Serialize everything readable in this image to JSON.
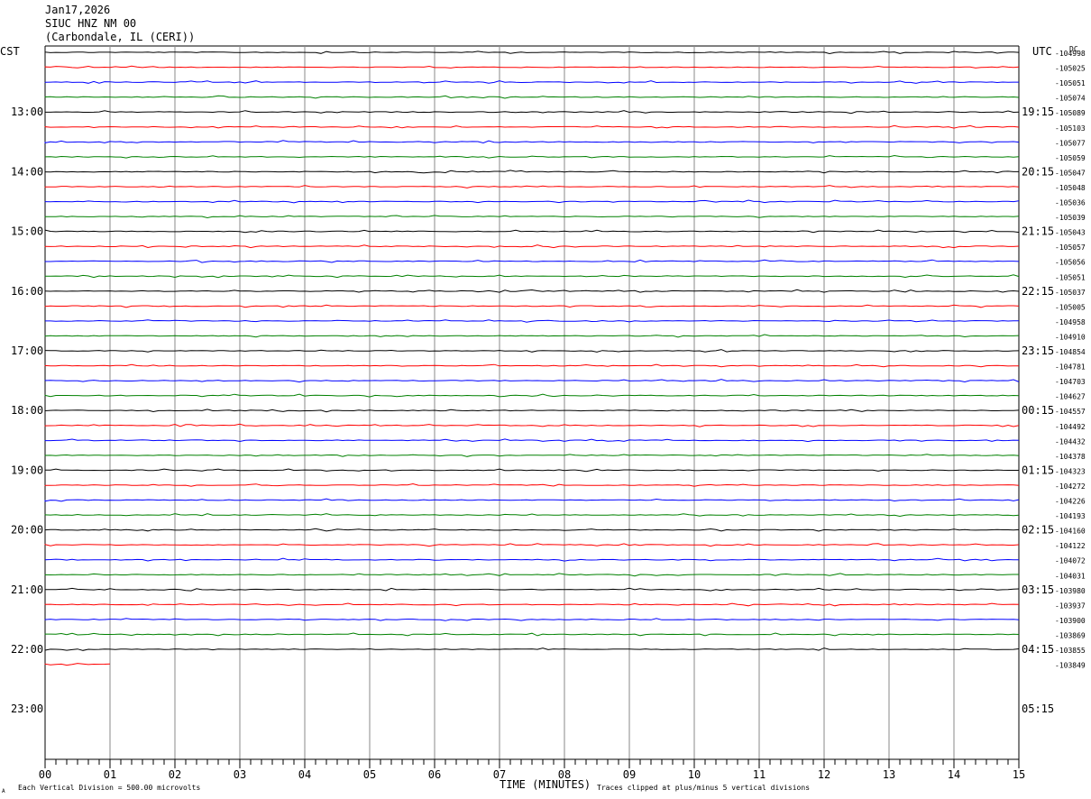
{
  "header": {
    "date": "Jan17,2026",
    "station": "SIUC HNZ NM 00",
    "location": "(Carbondale, IL (CERI))"
  },
  "left_axis_title": "CST",
  "right_axis_title": "UTC",
  "dc_title": "DC",
  "footer": {
    "note_left": "Each Vertical Division =  500.00 microvolts",
    "xlabel": "TIME (MINUTES)",
    "note_right": "Traces clipped at plus/minus 5 vertical divisions",
    "corner_mark": "A"
  },
  "chart_data": {
    "type": "line",
    "title": "",
    "xlabel": "TIME (MINUTES)",
    "ylabel": "CST",
    "x_ticks": [
      "00",
      "01",
      "02",
      "03",
      "04",
      "05",
      "06",
      "07",
      "08",
      "09",
      "10",
      "11",
      "12",
      "13",
      "14",
      "15"
    ],
    "xlim": [
      0,
      15
    ],
    "left_hour_labels": [
      "13:00",
      "14:00",
      "15:00",
      "16:00",
      "17:00",
      "18:00",
      "19:00",
      "20:00",
      "21:00",
      "22:00",
      "23:00"
    ],
    "right_hour_labels": [
      "19:15",
      "20:15",
      "21:15",
      "22:15",
      "23:15",
      "00:15",
      "01:15",
      "02:15",
      "03:15",
      "04:15",
      "05:15"
    ],
    "trace_colors": [
      "#000000",
      "#ff0000",
      "#0000ff",
      "#008000"
    ],
    "dc_values": [
      "-104998",
      "-105025",
      "-105051",
      "-105074",
      "-105089",
      "-105103",
      "-105077",
      "-105059",
      "-105047",
      "-105048",
      "-105036",
      "-105039",
      "-105043",
      "-105057",
      "-105056",
      "-105051",
      "-105037",
      "-105005",
      "-104958",
      "-104910",
      "-104854",
      "-104781",
      "-104703",
      "-104627",
      "-104557",
      "-104492",
      "-104432",
      "-104378",
      "-104323",
      "-104272",
      "-104226",
      "-104193",
      "-104160",
      "-104122",
      "-104072",
      "-104031",
      "-103980",
      "-103937",
      "-103900",
      "-103869",
      "-103855",
      "-103849"
    ],
    "last_trace_end_minute": 1.0,
    "grid": true
  }
}
